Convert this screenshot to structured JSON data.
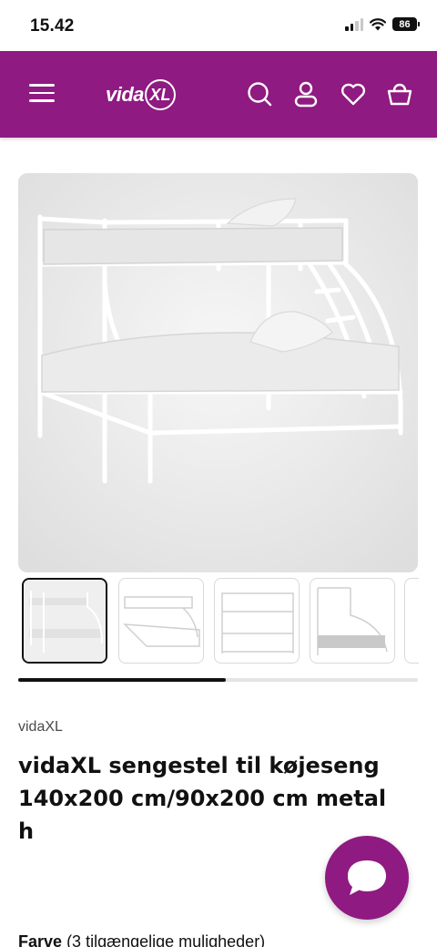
{
  "status": {
    "time": "15.42",
    "battery": "86"
  },
  "header": {
    "logo_text": "vida",
    "logo_badge": "XL",
    "icons": [
      "menu-icon",
      "search-icon",
      "account-icon",
      "wishlist-icon",
      "basket-icon"
    ],
    "background": "#8f1a81"
  },
  "gallery": {
    "thumbnail_count": 5,
    "active_index": 0,
    "scroll_progress": 0.52
  },
  "product": {
    "brand": "vidaXL",
    "title": "vidaXL sengestel til køjeseng 140x200 cm/90x200 cm metal h",
    "color_label": "Farve",
    "color_options": "(3 tilgængelige muligheder)"
  },
  "chat": {
    "icon": "chat-bubble-icon",
    "color": "#8f1a81"
  }
}
